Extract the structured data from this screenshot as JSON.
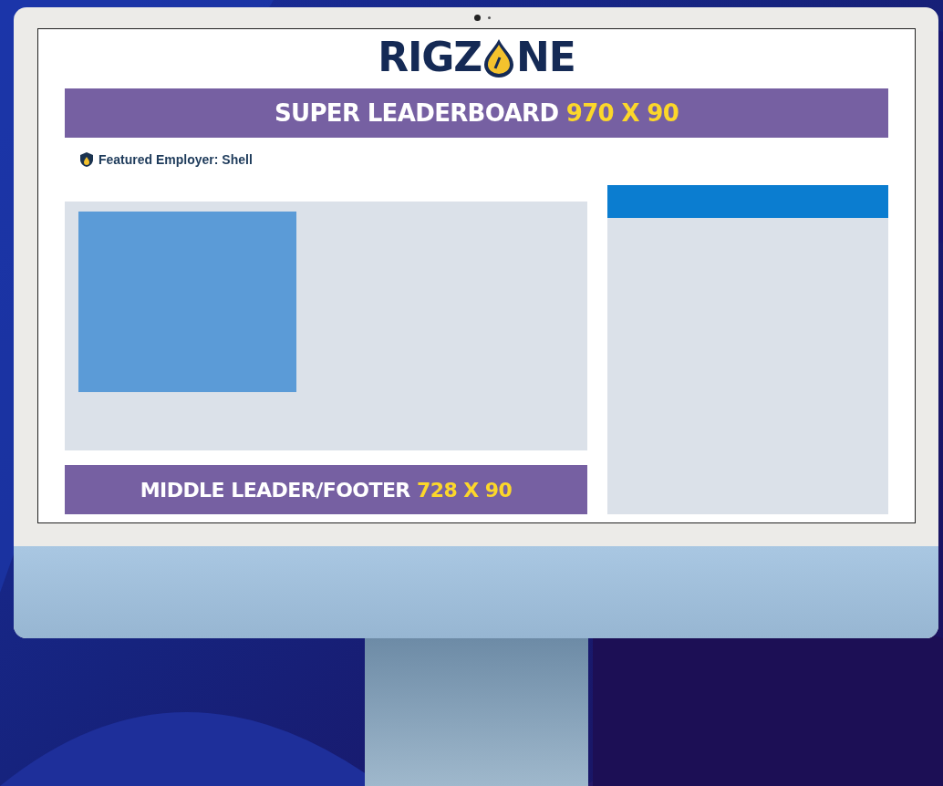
{
  "logo": {
    "before": "RIGZ",
    "after": "NE"
  },
  "super_leaderboard": {
    "label": "SUPER LEADERBOARD",
    "size": "970 X 90"
  },
  "featured_employer": {
    "text": "Featured Employer: Shell"
  },
  "middle_leader": {
    "label": "MIDDLE LEADER/FOOTER",
    "size": "728 X 90"
  }
}
